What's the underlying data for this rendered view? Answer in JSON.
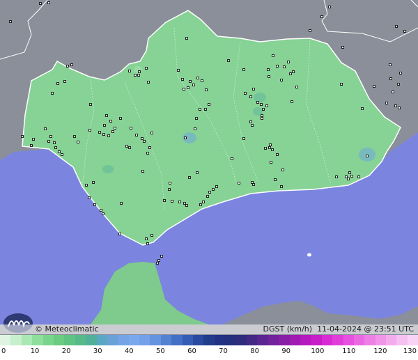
{
  "credit": "© Meteoclimatic",
  "product": {
    "label": "DGST (km/h)",
    "datetime": "11-04-2024 @ 23:51 UTC"
  },
  "legend": {
    "ticks": [
      "0",
      "10",
      "20",
      "30",
      "40",
      "50",
      "60",
      "70",
      "80",
      "90",
      "100",
      "110",
      "120",
      "130"
    ],
    "colors": [
      "#dff5e2",
      "#c6efcd",
      "#a9e8b3",
      "#8fde9c",
      "#79d58b",
      "#69cc80",
      "#5fc381",
      "#56ba89",
      "#50b19a",
      "#5ba8c4",
      "#6aa2d8",
      "#76a3e6",
      "#7aa8ee",
      "#74a0ea",
      "#6493df",
      "#5482d3",
      "#4370c4",
      "#355db5",
      "#2a4aa0",
      "#223c8c",
      "#213283",
      "#24307d",
      "#2f2b7d",
      "#442886",
      "#5a2591",
      "#72229b",
      "#8a1fa7",
      "#9f1bb2",
      "#b51ac0",
      "#c71ec9",
      "#d82bd3",
      "#e13ed9",
      "#e652df",
      "#ea69e2",
      "#ee7fe6",
      "#f195e9",
      "#f4abee",
      "#f6c0f2",
      "#f9d3f6"
    ]
  },
  "colors": {
    "sea": "#7b85e0",
    "land_gray": "#8a8f99",
    "andalusia": "#86d395",
    "morocco": "#7fca8d",
    "border": "#ffffff"
  },
  "icons": {
    "logo": "meteoclimatic-logo",
    "station": "station-marker"
  },
  "stations": [
    [
      58,
      5
    ],
    [
      70,
      4
    ],
    [
      15,
      31
    ],
    [
      83,
      120
    ],
    [
      93,
      117
    ],
    [
      97,
      95
    ],
    [
      103,
      93
    ],
    [
      75,
      134
    ],
    [
      32,
      196
    ],
    [
      48,
      200
    ],
    [
      45,
      209
    ],
    [
      65,
      185
    ],
    [
      73,
      196
    ],
    [
      70,
      203
    ],
    [
      78,
      205
    ],
    [
      80,
      212
    ],
    [
      85,
      218
    ],
    [
      89,
      222
    ],
    [
      107,
      196
    ],
    [
      112,
      204
    ],
    [
      130,
      150
    ],
    [
      129,
      187
    ],
    [
      143,
      190
    ],
    [
      149,
      193
    ],
    [
      156,
      195
    ],
    [
      150,
      180
    ],
    [
      159,
      174
    ],
    [
      165,
      184
    ],
    [
      162,
      189
    ],
    [
      153,
      166
    ],
    [
      173,
      170
    ],
    [
      182,
      210
    ],
    [
      186,
      212
    ],
    [
      188,
      184
    ],
    [
      196,
      194
    ],
    [
      204,
      199
    ],
    [
      207,
      203
    ],
    [
      212,
      220
    ],
    [
      218,
      191
    ],
    [
      215,
      212
    ],
    [
      205,
      246
    ],
    [
      186,
      102
    ],
    [
      194,
      108
    ],
    [
      213,
      118
    ],
    [
      199,
      108
    ],
    [
      210,
      98
    ],
    [
      200,
      103
    ],
    [
      256,
      101
    ],
    [
      264,
      128
    ],
    [
      270,
      126
    ],
    [
      273,
      117
    ],
    [
      278,
      122
    ],
    [
      262,
      114
    ],
    [
      284,
      112
    ],
    [
      290,
      116
    ],
    [
      296,
      129
    ],
    [
      300,
      150
    ],
    [
      295,
      157
    ],
    [
      287,
      157
    ],
    [
      282,
      170
    ],
    [
      280,
      185
    ],
    [
      266,
      198
    ],
    [
      268,
      55
    ],
    [
      328,
      87
    ],
    [
      352,
      134
    ],
    [
      360,
      139
    ],
    [
      364,
      128
    ],
    [
      370,
      147
    ],
    [
      375,
      150
    ],
    [
      378,
      157
    ],
    [
      376,
      166
    ],
    [
      383,
      152
    ],
    [
      392,
      80
    ],
    [
      385,
      100
    ],
    [
      386,
      110
    ],
    [
      398,
      95
    ],
    [
      404,
      115
    ],
    [
      408,
      96
    ],
    [
      414,
      89
    ],
    [
      417,
      106
    ],
    [
      421,
      103
    ],
    [
      350,
      100
    ],
    [
      360,
      175
    ],
    [
      362,
      180
    ],
    [
      376,
      170
    ],
    [
      350,
      199
    ],
    [
      381,
      213
    ],
    [
      387,
      212
    ],
    [
      391,
      215
    ],
    [
      388,
      208
    ],
    [
      389,
      233
    ],
    [
      398,
      222
    ],
    [
      406,
      244
    ],
    [
      362,
      262
    ],
    [
      364,
      265
    ],
    [
      395,
      258
    ],
    [
      343,
      263
    ],
    [
      404,
      268
    ],
    [
      333,
      228
    ],
    [
      311,
      268
    ],
    [
      306,
      272
    ],
    [
      301,
      276
    ],
    [
      298,
      282
    ],
    [
      292,
      290
    ],
    [
      288,
      294
    ],
    [
      265,
      292
    ],
    [
      268,
      295
    ],
    [
      244,
      263
    ],
    [
      236,
      288
    ],
    [
      272,
      255
    ],
    [
      283,
      248
    ],
    [
      419,
      146
    ],
    [
      426,
      125
    ],
    [
      490,
      121
    ],
    [
      492,
      68
    ],
    [
      520,
      156
    ],
    [
      483,
      254
    ],
    [
      497,
      254
    ],
    [
      500,
      257
    ],
    [
      505,
      253
    ],
    [
      502,
      248
    ],
    [
      515,
      254
    ],
    [
      527,
      224
    ],
    [
      555,
      148
    ],
    [
      564,
      132
    ],
    [
      568,
      152
    ],
    [
      573,
      155
    ],
    [
      569,
      38
    ],
    [
      560,
      93
    ],
    [
      561,
      113
    ],
    [
      572,
      121
    ],
    [
      537,
      124
    ],
    [
      575,
      105
    ],
    [
      581,
      45
    ],
    [
      473,
      10
    ],
    [
      462,
      24
    ],
    [
      445,
      44
    ],
    [
      124,
      266
    ],
    [
      134,
      262
    ],
    [
      128,
      284
    ],
    [
      136,
      294
    ],
    [
      145,
      302
    ],
    [
      148,
      307
    ],
    [
      174,
      292
    ],
    [
      172,
      336
    ],
    [
      210,
      343
    ],
    [
      212,
      350
    ],
    [
      218,
      338
    ],
    [
      232,
      368
    ],
    [
      228,
      374
    ],
    [
      226,
      378
    ],
    [
      243,
      272
    ],
    [
      247,
      289
    ],
    [
      258,
      290
    ]
  ]
}
